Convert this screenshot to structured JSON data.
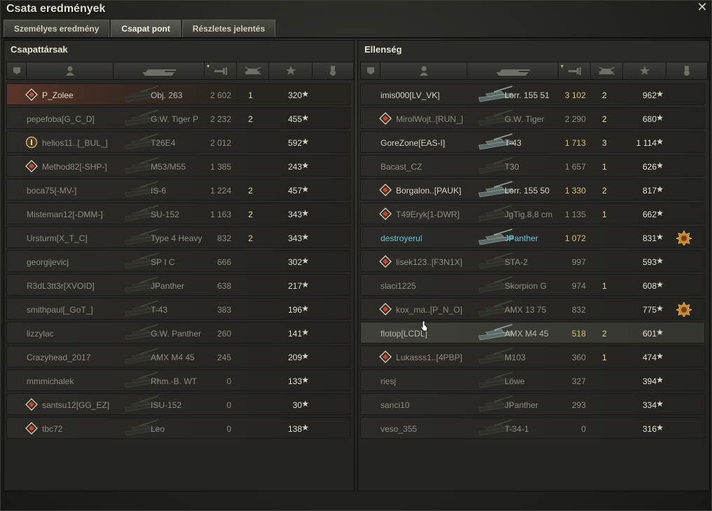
{
  "window": {
    "title": "Csata eredmények",
    "close_glyph": "✕"
  },
  "tabs": [
    {
      "label": "Személyes eredmény",
      "active": false
    },
    {
      "label": "Csapat pont",
      "active": true
    },
    {
      "label": "Részletes jelentés",
      "active": false
    }
  ],
  "headers": {
    "icons": [
      "platoon-icon",
      "player-icon",
      "vehicle-icon",
      "damage-icon",
      "kills-icon",
      "xp-star-icon",
      "medal-icon"
    ]
  },
  "star_glyph": "★",
  "team": {
    "title": "Csapattársak",
    "rows": [
      {
        "name": "P_Zolee",
        "vehicle": "Obj. 263",
        "damage": "2 602",
        "kills": "1",
        "xp": "320",
        "icon": "diamond-icon",
        "state": "self"
      },
      {
        "name": "pepefoba[G_C_D]",
        "vehicle": "G.W. Tiger P",
        "damage": "2 232",
        "kills": "2",
        "xp": "455",
        "icon": "",
        "state": "dead"
      },
      {
        "name": "helios11..[_BUL_]",
        "vehicle": "T26E4",
        "damage": "2 012",
        "kills": "",
        "xp": "592",
        "icon": "platoon-1-icon",
        "state": "dead"
      },
      {
        "name": "Method82[-SHP-]",
        "vehicle": "M53/M55",
        "damage": "1 385",
        "kills": "",
        "xp": "243",
        "icon": "diamond-icon",
        "state": "dead"
      },
      {
        "name": "boca75[-MV-]",
        "vehicle": "IS-6",
        "damage": "1 224",
        "kills": "2",
        "xp": "457",
        "icon": "",
        "state": "dead"
      },
      {
        "name": "Misteman12[-DMM-]",
        "vehicle": "SU-152",
        "damage": "1 163",
        "kills": "2",
        "xp": "343",
        "icon": "",
        "state": "dead"
      },
      {
        "name": "Ursturm[X_T_C]",
        "vehicle": "Type 4 Heavy",
        "damage": "832",
        "kills": "2",
        "xp": "343",
        "icon": "",
        "state": "dead"
      },
      {
        "name": "georgijevicj",
        "vehicle": "SP I C",
        "damage": "666",
        "kills": "",
        "xp": "302",
        "icon": "",
        "state": "dead"
      },
      {
        "name": "R3dL3tt3r[XVOID]",
        "vehicle": "JPanther",
        "damage": "638",
        "kills": "",
        "xp": "217",
        "icon": "",
        "state": "dead"
      },
      {
        "name": "smithpaul[_GoT_]",
        "vehicle": "T-43",
        "damage": "383",
        "kills": "",
        "xp": "196",
        "icon": "",
        "state": "dead"
      },
      {
        "name": "lizzylac",
        "vehicle": "G.W. Panther",
        "damage": "260",
        "kills": "",
        "xp": "141",
        "icon": "",
        "state": "dead"
      },
      {
        "name": "Crazyhead_2017",
        "vehicle": "AMX M4 45",
        "damage": "245",
        "kills": "",
        "xp": "209",
        "icon": "",
        "state": "dead"
      },
      {
        "name": "mmmichalek",
        "vehicle": "Rhm.-B. WT",
        "damage": "0",
        "kills": "",
        "xp": "133",
        "icon": "",
        "state": "dead"
      },
      {
        "name": "santsu12[GG_EZ]",
        "vehicle": "ISU-152",
        "damage": "0",
        "kills": "",
        "xp": "30",
        "icon": "diamond-icon",
        "state": "dead"
      },
      {
        "name": "tbc72",
        "vehicle": "Leo",
        "damage": "0",
        "kills": "",
        "xp": "138",
        "icon": "diamond-icon",
        "state": "dead"
      }
    ]
  },
  "enemy": {
    "title": "Ellenség",
    "rows": [
      {
        "name": "imis000[LV_VK]",
        "vehicle": "Lorr. 155 51",
        "damage": "3 102",
        "kills": "2",
        "xp": "962",
        "icon": "",
        "state": "alive",
        "hi": true
      },
      {
        "name": "MirolWojt..[RUN_]",
        "vehicle": "G.W. Tiger",
        "damage": "2 290",
        "kills": "2",
        "xp": "680",
        "icon": "diamond-icon",
        "state": "dead"
      },
      {
        "name": "GoreZone[EAS-I]",
        "vehicle": "T-43",
        "damage": "1 713",
        "kills": "3",
        "xp": "1 114",
        "icon": "",
        "state": "alive",
        "hi": true
      },
      {
        "name": "Bacast_CZ",
        "vehicle": "T30",
        "damage": "1 657",
        "kills": "1",
        "xp": "626",
        "icon": "",
        "state": "dead"
      },
      {
        "name": "Borgalon..[PAUK]",
        "vehicle": "Lorr. 155 50",
        "damage": "1 330",
        "kills": "2",
        "xp": "817",
        "icon": "diamond-icon",
        "state": "alive",
        "hi": true
      },
      {
        "name": "T49Eryk[1-DWR]",
        "vehicle": "JgTig.8,8 cm",
        "damage": "1 135",
        "kills": "1",
        "xp": "662",
        "icon": "diamond-icon",
        "state": "dead"
      },
      {
        "name": "destroyerul",
        "vehicle": "JPanther",
        "damage": "1 072",
        "kills": "",
        "xp": "831",
        "icon": "",
        "state": "player",
        "hi": true,
        "medal": true
      },
      {
        "name": "lisek123..[F3N1X]",
        "vehicle": "STA-2",
        "damage": "997",
        "kills": "",
        "xp": "593",
        "icon": "diamond-icon",
        "state": "dead"
      },
      {
        "name": "slaci1225",
        "vehicle": "Skorpion G",
        "damage": "974",
        "kills": "1",
        "xp": "608",
        "icon": "",
        "state": "dead"
      },
      {
        "name": "kox_ma..[P_N_O]",
        "vehicle": "AMX 13 75",
        "damage": "832",
        "kills": "",
        "xp": "775",
        "icon": "diamond-icon",
        "state": "dead",
        "medal": true
      },
      {
        "name": "flotop[LCDL]",
        "vehicle": "AMX M4 45",
        "damage": "518",
        "kills": "2",
        "xp": "601",
        "icon": "",
        "state": "hover",
        "hi": true
      },
      {
        "name": "Lukasss1..[4PBP]",
        "vehicle": "M103",
        "damage": "360",
        "kills": "1",
        "xp": "474",
        "icon": "diamond-icon",
        "state": "dead"
      },
      {
        "name": "riesj",
        "vehicle": "Löwe",
        "damage": "327",
        "kills": "",
        "xp": "394",
        "icon": "",
        "state": "dead"
      },
      {
        "name": "sanci10",
        "vehicle": "JPanther",
        "damage": "293",
        "kills": "",
        "xp": "334",
        "icon": "",
        "state": "dead"
      },
      {
        "name": "veso_355",
        "vehicle": "T-34-1",
        "damage": "0",
        "kills": "",
        "xp": "316",
        "icon": "",
        "state": "dead"
      }
    ]
  }
}
